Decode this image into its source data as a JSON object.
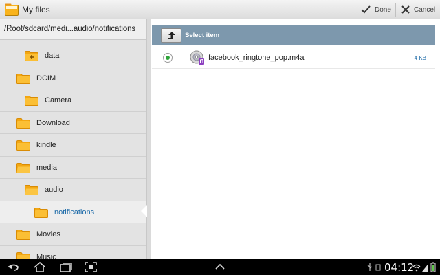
{
  "actionbar": {
    "title": "My files",
    "done_label": "Done",
    "cancel_label": "Cancel"
  },
  "leftpanel": {
    "path": "/Root/sdcard/medi...audio/notifications",
    "tree": [
      {
        "label": "data",
        "level": 1,
        "icon": "folder-plus-icon"
      },
      {
        "label": "DCIM",
        "level": 0,
        "icon": "folder-icon"
      },
      {
        "label": "Camera",
        "level": 1,
        "icon": "folder-icon"
      },
      {
        "label": "Download",
        "level": 0,
        "icon": "folder-icon"
      },
      {
        "label": "kindle",
        "level": 0,
        "icon": "folder-icon"
      },
      {
        "label": "media",
        "level": 0,
        "icon": "folder-open-icon"
      },
      {
        "label": "audio",
        "level": 1,
        "icon": "folder-open-icon"
      },
      {
        "label": "notifications",
        "level": 2,
        "icon": "folder-icon",
        "selected": true
      },
      {
        "label": "Movies",
        "level": 0,
        "icon": "folder-icon"
      },
      {
        "label": "Music",
        "level": 0,
        "icon": "folder-icon"
      }
    ]
  },
  "rightpanel": {
    "header_title": "Select item",
    "files": [
      {
        "name": "facebook_ringtone_pop.m4a",
        "size": "4 KB",
        "selected": true
      }
    ]
  },
  "sysbar": {
    "time": "04:12"
  },
  "colors": {
    "accent": "#1c6aa8",
    "header": "#7d98ad",
    "radio_selected": "#2fa53a",
    "folder": "#f9b31b"
  }
}
